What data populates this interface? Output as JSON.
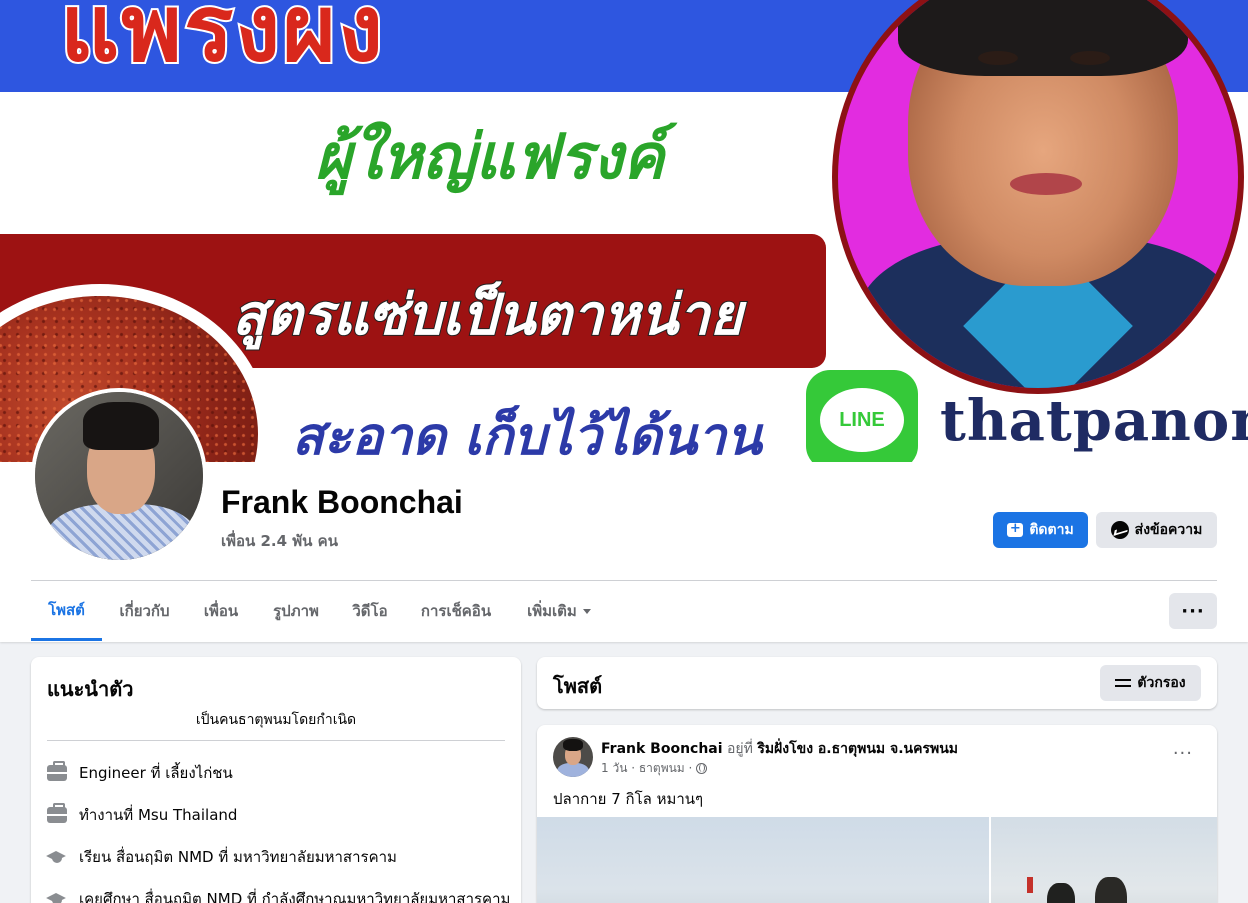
{
  "cover": {
    "top_word": "แพรงผง",
    "green_text": "ผู้ใหญ่แฟรงค์",
    "red_band_text": "สูตรแซ่บเป็นตาหน่าย",
    "blue_text": "สะอาด เก็บไว้ได้นาน",
    "line_label": "LINE",
    "line_id": "thatpanom"
  },
  "profile": {
    "name": "Frank Boonchai",
    "friends": "เพื่อน 2.4 พัน คน",
    "follow_label": "ติดตาม",
    "message_label": "ส่งข้อความ",
    "more_options_label": "···"
  },
  "tabs": [
    {
      "label": "โพสต์",
      "active": true
    },
    {
      "label": "เกี่ยวกับ"
    },
    {
      "label": "เพื่อน"
    },
    {
      "label": "รูปภาพ"
    },
    {
      "label": "วิดีโอ"
    },
    {
      "label": "การเช็คอิน"
    },
    {
      "label": "เพิ่มเติม"
    }
  ],
  "intro": {
    "title": "แนะนำตัว",
    "bio": "เป็นคนธาตุพนมโดยกำเนิด",
    "items": [
      {
        "icon": "briefcase-icon",
        "prefix": "Engineer ที่ ",
        "bold": "เลี้ยงไก่ชน"
      },
      {
        "icon": "briefcase-icon",
        "prefix": "ทำงานที่ ",
        "bold": "Msu Thailand"
      },
      {
        "icon": "graduation-cap-icon",
        "prefix": "เรียน สื่อนฤมิต NMD ที่ ",
        "bold": "มหาวิทยาลัยมหาสารคาม"
      },
      {
        "icon": "graduation-cap-icon",
        "prefix": "เคยศึกษา สื่อนฤมิต NMD ที่ ",
        "bold": "กำลังศึกษาณมหาวิทยาลัยมหาสารคาม"
      }
    ]
  },
  "posts_header": {
    "title": "โพสต์",
    "filter_label": "ตัวกรอง"
  },
  "post": {
    "author": "Frank Boonchai",
    "at_word": " อยู่ที่ ",
    "place": "ริมฝั่งโขง อ.ธาตุพนม จ.นครพนม",
    "meta": "1 วัน · ธาตุพนม ·",
    "text": "ปลากาย 7 กิโล หมานๆ",
    "dots": "···"
  },
  "colors": {
    "accent": "#1b74e4",
    "page_bg": "#f0f2f5",
    "secondary_text": "#65676b",
    "button_gray": "#e4e6eb"
  }
}
